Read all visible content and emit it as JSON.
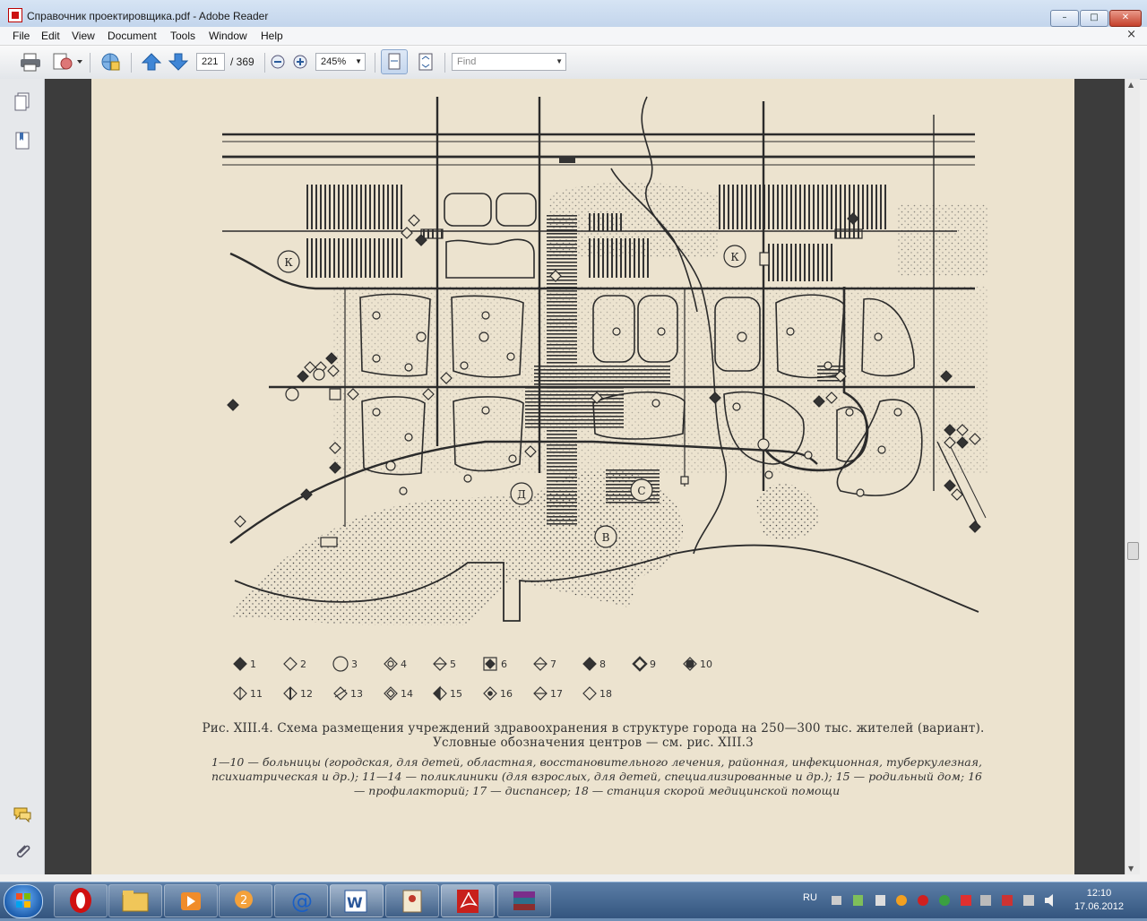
{
  "window": {
    "title": "Справочник проектировщика.pdf - Adobe Reader",
    "min_label": "–",
    "max_label": "□",
    "close_label": "✕"
  },
  "menu": {
    "items": [
      "File",
      "Edit",
      "View",
      "Document",
      "Tools",
      "Window",
      "Help"
    ],
    "close_label": "×"
  },
  "toolbar": {
    "page_current": "221",
    "page_total": "/ 369",
    "zoom": "245%",
    "find_placeholder": "Find"
  },
  "figure": {
    "caption_title": "Рис. XIII.4. Схема размещения учреждений здравоохранения в структуре города на 250—300 тыс. жителей (вариант). Условные обозначения центров — см. рис. XIII.3",
    "caption_body": "1—10 — больницы (городская, для детей, областная, восстановительного лечения, районная, инфекционная, туберкулезная, психиатрическая и др.); 11—14 — поликлиники (для взрослых, для детей, специализированные и др.); 15 — родильный дом; 16 — профилакторий; 17 — диспансер; 18 — станция скорой медицинской помощи",
    "legend": [
      "1",
      "2",
      "3",
      "4",
      "5",
      "6",
      "7",
      "8",
      "9",
      "10",
      "11",
      "12",
      "13",
      "14",
      "15",
      "16",
      "17",
      "18"
    ],
    "map_labels": [
      "К",
      "К",
      "Д",
      "С",
      "В"
    ]
  },
  "taskbar": {
    "language": "RU",
    "time": "12:10",
    "date": "17.06.2012",
    "apps": [
      "opera-icon",
      "explorer-icon",
      "media-player-icon",
      "pidgin-icon",
      "mail-icon",
      "word-icon",
      "contacts-icon",
      "acrobat-reader-icon",
      "winrar-icon"
    ]
  }
}
